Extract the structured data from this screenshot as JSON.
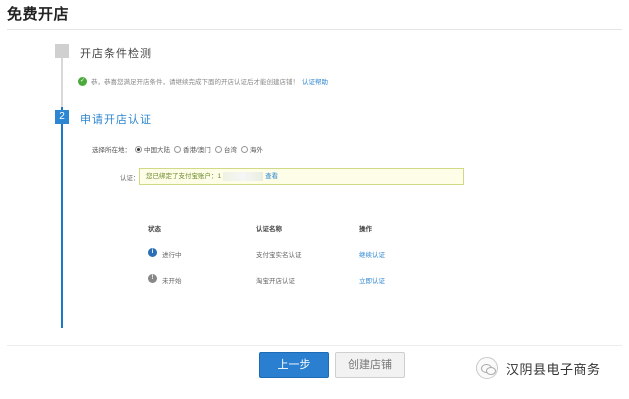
{
  "page": {
    "title": "免费开店"
  },
  "step1": {
    "number": "",
    "title": "开店条件检测",
    "check_text": "恭，恭喜您满足开店条件，请继续完成下面的开店认证后才能创建店铺！",
    "check_link": "认证帮助"
  },
  "step2": {
    "number": "2",
    "title": "申请开店认证",
    "region": {
      "label": "选择所在地：",
      "options": [
        "中国大陆",
        "香港/澳门",
        "台湾",
        "海外"
      ],
      "selected": "中国大陆"
    },
    "auth": {
      "label": "认证：",
      "message": "您已绑定了支付宝账户：1",
      "view_link": "查看"
    },
    "table": {
      "headers": [
        "状态",
        "认证名称",
        "操作"
      ],
      "rows": [
        {
          "status": "进行中",
          "name": "支付宝实名认证",
          "action": "继续认证",
          "icon": "info-icon"
        },
        {
          "status": "未开始",
          "name": "淘宝开店认证",
          "action": "立即认证",
          "icon": "pending-icon"
        }
      ]
    }
  },
  "buttons": {
    "prev": "上一步",
    "create": "创建店铺"
  },
  "watermark": {
    "text": "汉阴县电子商务"
  },
  "colors": {
    "accent": "#2d86d1",
    "success": "#4caa3c",
    "notice_bg": "#fdfde8"
  }
}
